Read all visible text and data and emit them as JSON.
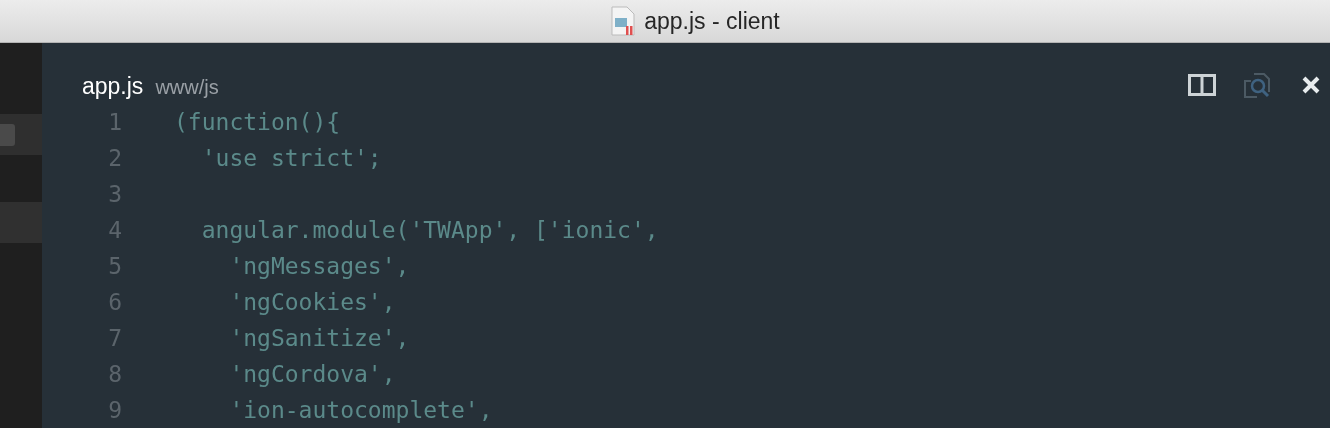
{
  "window": {
    "title": "app.js - client"
  },
  "sidebar": {
    "items": [
      {
        "selected": true
      },
      {
        "selected": false
      }
    ]
  },
  "editor": {
    "file_name": "app.js",
    "path": "www/js",
    "lines": [
      {
        "number": "1",
        "code": "(function(){"
      },
      {
        "number": "2",
        "code": "  'use strict';"
      },
      {
        "number": "3"
      },
      {
        "number": "4",
        "code": "  angular.module('TWApp', ['ionic',"
      },
      {
        "number": "5",
        "code": "    'ngMessages',"
      },
      {
        "number": "6",
        "code": "    'ngCookies',"
      },
      {
        "number": "7",
        "code": "    'ngSanitize',"
      },
      {
        "number": "8",
        "code": "    'ngCordova',"
      },
      {
        "number": "9",
        "code": "    'ion-autocomplete',"
      }
    ]
  }
}
